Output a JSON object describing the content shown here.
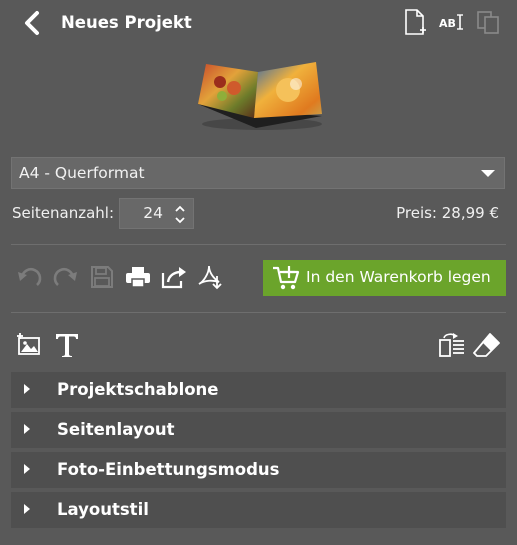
{
  "header": {
    "title": "Neues Projekt",
    "icons": [
      "back-arrow-icon",
      "new-page-icon",
      "text-field-icon",
      "duplicate-page-icon"
    ]
  },
  "format": {
    "selected": "A4 - Querformat"
  },
  "pages": {
    "label": "Seitenanzahl:",
    "value": "24"
  },
  "price": {
    "text": "Preis: 28,99 €"
  },
  "toolbar": {
    "icons": [
      "undo-icon",
      "redo-icon",
      "save-icon",
      "print-icon",
      "share-icon",
      "export-pdf-icon"
    ],
    "cart_label": "In den Warenkorb legen"
  },
  "tools": {
    "icons": [
      "add-image-icon",
      "add-text-icon",
      "replace-icon",
      "eraser-icon"
    ]
  },
  "accordion": [
    {
      "label": "Projektschablone"
    },
    {
      "label": "Seitenlayout"
    },
    {
      "label": "Foto-Einbettungsmodus"
    },
    {
      "label": "Layoutstil"
    }
  ],
  "colors": {
    "background": "#595959",
    "accent_green": "#6ba42b",
    "panel": "#4f4f4f"
  }
}
